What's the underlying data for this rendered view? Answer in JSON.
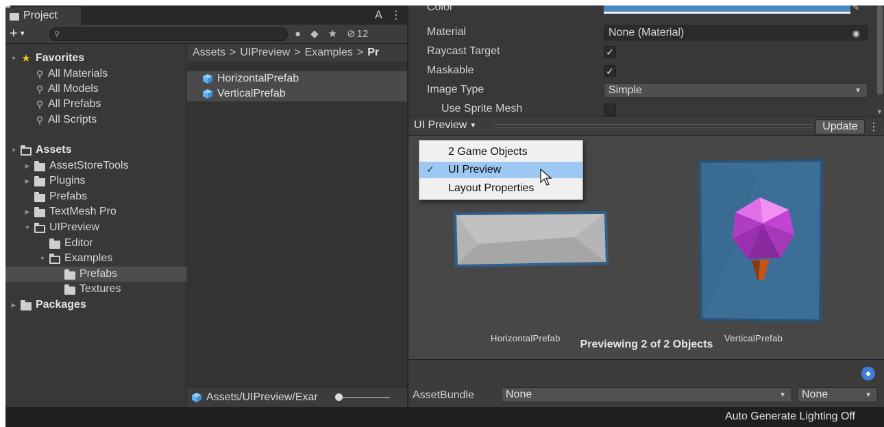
{
  "project": {
    "tab_title": "Project",
    "hidden_count": "12",
    "search_placeholder": "",
    "tree": {
      "favorites_label": "Favorites",
      "favorites": [
        "All Materials",
        "All Models",
        "All Prefabs",
        "All Scripts"
      ],
      "assets_label": "Assets",
      "folders": {
        "asset_store_tools": "AssetStoreTools",
        "plugins": "Plugins",
        "prefabs": "Prefabs",
        "textmesh_pro": "TextMesh Pro",
        "uipreview": "UIPreview",
        "editor": "Editor",
        "examples": "Examples",
        "examples_prefabs": "Prefabs",
        "textures": "Textures"
      },
      "packages_label": "Packages"
    },
    "breadcrumb": [
      "Assets",
      "UIPreview",
      "Examples",
      "Pr"
    ],
    "breadcrumb_sep": ">",
    "files": [
      "HorizontalPrefab",
      "VerticalPrefab"
    ],
    "footer_path": "Assets/UIPreview/Exar"
  },
  "inspector": {
    "properties": {
      "color_label": "Color",
      "material_label": "Material",
      "material_value": "None (Material)",
      "raycast_label": "Raycast Target",
      "maskable_label": "Maskable",
      "image_type_label": "Image Type",
      "image_type_value": "Simple",
      "sprite_mesh_label": "Use Sprite Mesh"
    },
    "checkmark": "✓",
    "preview": {
      "selector_label": "UI Preview",
      "update_button": "Update",
      "items": [
        {
          "label": "HorizontalPrefab"
        },
        {
          "label": "VerticalPrefab"
        }
      ],
      "status": "Previewing 2 of 2 Objects"
    },
    "menu": {
      "items": [
        "2 Game Objects",
        "UI Preview",
        "Layout Properties"
      ],
      "selected_index": 1
    },
    "asset_bundle": {
      "label": "AssetBundle",
      "name_value": "None",
      "variant_value": "None"
    }
  },
  "statusbar": {
    "text": "Auto Generate Lighting Off"
  },
  "colors": {
    "color_property": "#4a86c0",
    "menu_highlight": "#9ec8f4",
    "prefab_icon": "#5fb3f0",
    "favorite_star": "#f5c518",
    "gem": "#d94fd9",
    "panel_blue": "#3b6f98"
  },
  "icons": {
    "folder": "folder-icon",
    "prefab": "prefab-icon",
    "search": "search-icon",
    "star": "star-icon",
    "lock": "lock-icon",
    "more": "more-icon",
    "eye_hidden": "eye-hidden-icon",
    "tag": "tag-icon",
    "target": "object-picker-icon"
  }
}
